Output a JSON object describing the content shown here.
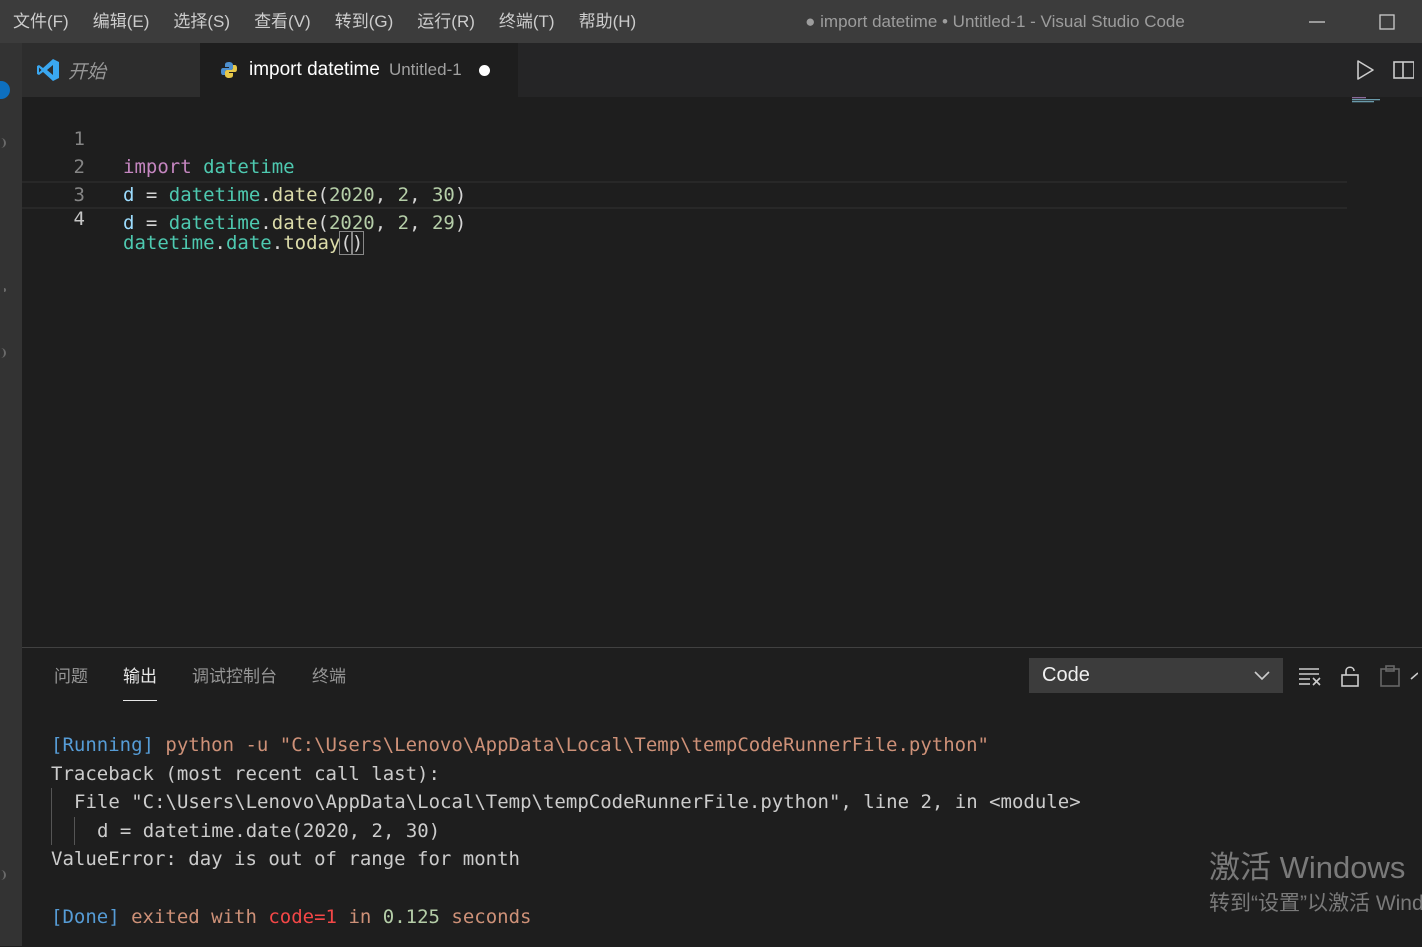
{
  "menu": [
    "文件(F)",
    "编辑(E)",
    "选择(S)",
    "查看(V)",
    "转到(G)",
    "运行(R)",
    "终端(T)",
    "帮助(H)"
  ],
  "window_title": "● import datetime • Untitled-1 - Visual Studio Code",
  "tabs": {
    "start": {
      "label": "开始"
    },
    "active": {
      "label": "import datetime",
      "description": "Untitled-1"
    }
  },
  "editor": {
    "line_numbers": [
      "1",
      "2",
      "3",
      "4"
    ],
    "lines": [
      {
        "kw": "import",
        "mod": "datetime"
      },
      {
        "var": "d",
        "eq": " = ",
        "mod": "datetime",
        "dot": ".",
        "fn": "date",
        "open": "(",
        "n1": "2020",
        "sep1": ", ",
        "n2": "2",
        "sep2": ", ",
        "n3": "30",
        "close": ")"
      },
      {
        "var": "d",
        "eq": " = ",
        "mod": "datetime",
        "dot": ".",
        "fn": "date",
        "open": "(",
        "n1": "2020",
        "sep1": ", ",
        "n2": "2",
        "sep2": ", ",
        "n3": "29",
        "close": ")"
      },
      {
        "mod": "datetime",
        "dot1": ".",
        "attr": "date",
        "dot2": ".",
        "fn": "today",
        "open": "(",
        "close": ")"
      }
    ]
  },
  "panel": {
    "tabs": [
      "问题",
      "输出",
      "调试控制台",
      "终端"
    ],
    "active_tab": "输出",
    "output_channel": "Code",
    "output": {
      "running_tag": "[Running]",
      "running_cmd": " python -u \"C:\\Users\\Lenovo\\AppData\\Local\\Temp\\tempCodeRunnerFile.python\"",
      "traceback": "Traceback (most recent call last):",
      "file_line": "File \"C:\\Users\\Lenovo\\AppData\\Local\\Temp\\tempCodeRunnerFile.python\", line 2, in <module>",
      "code_line": "d = datetime.date(2020, 2, 30)",
      "error": "ValueError: day is out of range for month",
      "done_tag": "[Done]",
      "done_exited": " exited with ",
      "done_code": "code=1",
      "done_in": " in ",
      "done_time": "0.125",
      "done_seconds": " seconds"
    }
  },
  "watermark": {
    "line1": "激活 Windows",
    "line2": "转到“设置”以激活 Windows。"
  },
  "colors": {
    "accent": "#0e70c0",
    "titlebar": "#3c3c3c",
    "editor_bg": "#1e1e1e",
    "error_code": "#f44747"
  }
}
